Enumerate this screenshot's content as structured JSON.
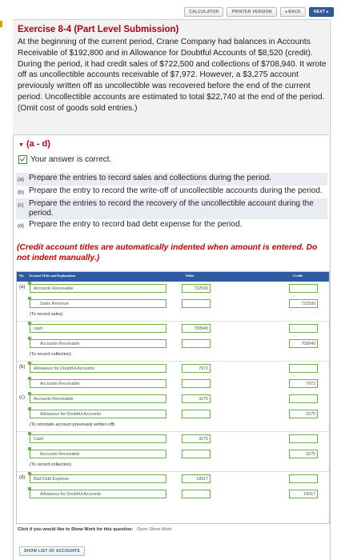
{
  "topnav": {
    "calculator": "CALCULATOR",
    "printer": "PRINTER VERSION",
    "back": "◂ BACK",
    "next": "NEXT ▸"
  },
  "exercise": {
    "title": "Exercise 8-4 (Part Level Submission)",
    "body": "At the beginning of the current period, Crane Company had balances in Accounts Receivable of $192,800 and in Allowance for Doubtful Accounts of $8,520 (credit). During the period, it had credit sales of $722,500 and collections of $708,940. It wrote off as uncollectible accounts receivable of $7,972. However, a $3,275 account previously written off as uncollectible was recovered before the end of the current period. Uncollectible accounts are estimated to total $22,740 at the end of the period. (Omit cost of goods sold entries.)"
  },
  "section": {
    "label": "(a - d)",
    "correct": "Your answer is correct."
  },
  "parts": [
    {
      "label": "(a)",
      "text": "Prepare the entries to record sales and collections during the period."
    },
    {
      "label": "(b)",
      "text": "Prepare the entry to record the write-off of uncollectible accounts during the period."
    },
    {
      "label": "(c)",
      "text": "Prepare the entries to record the recovery of the uncollectible account during the period."
    },
    {
      "label": "(d)",
      "text": "Prepare the entry to record bad debt expense for the period."
    }
  ],
  "note": "(Credit account titles are automatically indented when amount is entered. Do not indent manually.)",
  "table": {
    "headers": {
      "no": "No.",
      "account": "Account Titles and Explanation",
      "debit": "Debit",
      "credit": "Credit"
    },
    "rows": [
      {
        "part": "(a)",
        "account": "Accounts Receivable",
        "debit": "722500",
        "credit": ""
      },
      {
        "part": "",
        "account": "Sales Revenue",
        "debit": "",
        "credit": "722500"
      },
      {
        "part": "",
        "note": "(To record sales)"
      },
      {
        "part": "",
        "account": "cash",
        "debit": "708940",
        "credit": ""
      },
      {
        "part": "",
        "account": "Accounts Receivable",
        "debit": "",
        "credit": "708940"
      },
      {
        "part": "",
        "note": "(To record collection)"
      },
      {
        "part": "(b)",
        "account": "Allowance for Doubtful Accounts",
        "debit": "7972",
        "credit": ""
      },
      {
        "part": "",
        "account": "Accounts Receivable",
        "debit": "",
        "credit": "7972"
      },
      {
        "part": "(c)",
        "account": "Accounts Receivable",
        "debit": "3275",
        "credit": ""
      },
      {
        "part": "",
        "account": "Allowance for Doubtful Accounts",
        "debit": "",
        "credit": "3275"
      },
      {
        "part": "",
        "note": "(To reinstate account previously written off)"
      },
      {
        "part": "",
        "account": "Cash",
        "debit": "3275",
        "credit": ""
      },
      {
        "part": "",
        "account": "Accounts Receivable",
        "debit": "",
        "credit": "3275"
      },
      {
        "part": "",
        "note": "(To record collection)"
      },
      {
        "part": "(d)",
        "account": "Bad Debt Expense",
        "debit": "18917",
        "credit": ""
      },
      {
        "part": "",
        "account": "Allowance for Doubtful Accounts",
        "debit": "",
        "credit": "18917"
      }
    ]
  },
  "showwork": {
    "question": "Click if you would like to Show Work for this question:",
    "link": "Open Show Work"
  },
  "showlist": "SHOW LIST OF ACCOUNTS",
  "colors": {
    "accent": "#b3001b",
    "header_blue": "#2d5aa3",
    "field_green": "#6cae48"
  }
}
